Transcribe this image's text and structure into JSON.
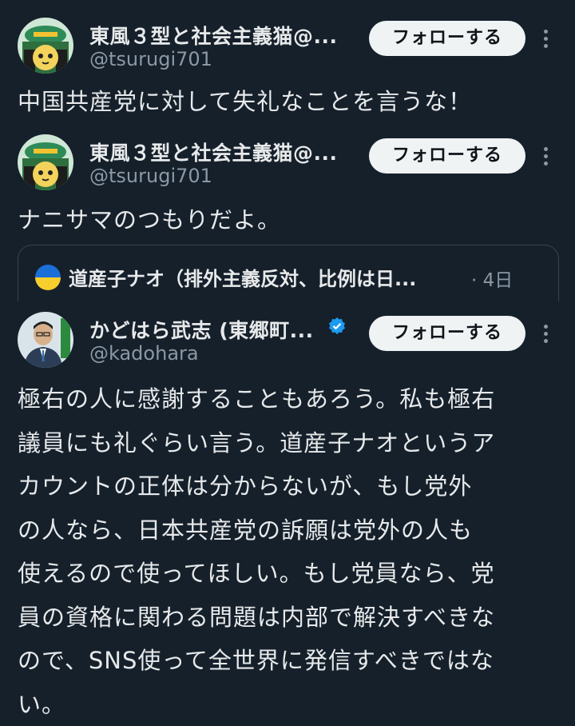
{
  "tweets": [
    {
      "author_name": "東風３型と社会主義猫@...",
      "handle": "@tsurugi701",
      "follow_label": "フォローする",
      "text": "中国共産党に対して失礼なことを言うな！"
    },
    {
      "author_name": "東風３型と社会主義猫@...",
      "handle": "@tsurugi701",
      "follow_label": "フォローする",
      "text": "ナニサマのつもりだよ。"
    }
  ],
  "quoted": {
    "author_name": "道産子ナオ（排外主義反対、比例は日...",
    "time": "· 4日"
  },
  "main_tweet": {
    "author_name": "かどはら武志 (東郷町...",
    "handle": "@kadohara",
    "follow_label": "フォローする",
    "lines": [
      "極右の人に感謝することもあろう。私も極右",
      "議員にも礼ぐらい言う。道産子ナオというア",
      "カウントの正体は分からないが、もし党外",
      "の人なら、日本共産党の訴願は党外の人も",
      "使えるので使ってほしい。もし党員なら、党",
      "員の資格に関わる問題は内部で解決すべきな",
      "ので、SNS使って全世界に発信すべきではな",
      "い。"
    ]
  },
  "colors": {
    "background": "#15202b",
    "text": "#e7e9ea",
    "secondary": "#8b98a5",
    "verified": "#1d9bf0"
  }
}
